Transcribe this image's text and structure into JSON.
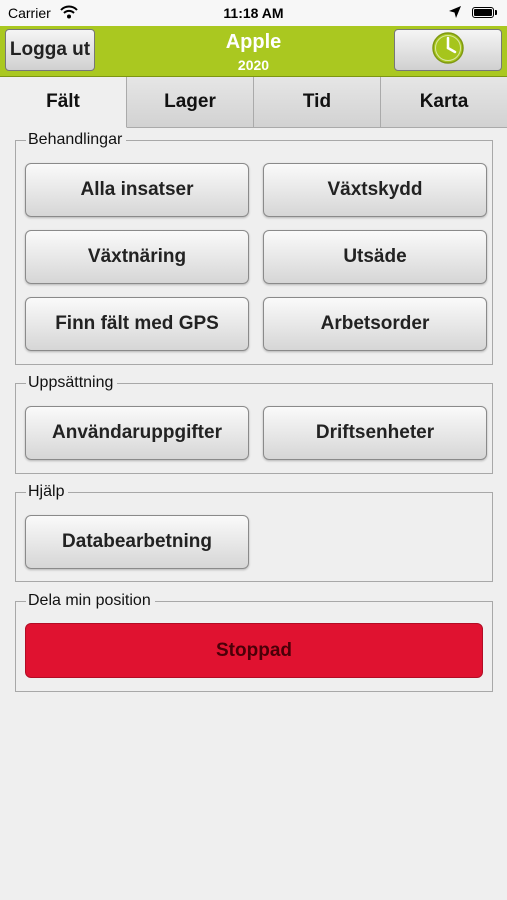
{
  "status_bar": {
    "carrier": "Carrier",
    "time": "11:18 AM"
  },
  "header": {
    "logout_label": "Logga ut",
    "title": "Apple",
    "subtitle": "2020"
  },
  "tabs": [
    {
      "label": "Fält",
      "active": true
    },
    {
      "label": "Lager",
      "active": false
    },
    {
      "label": "Tid",
      "active": false
    },
    {
      "label": "Karta",
      "active": false
    }
  ],
  "sections": {
    "behandlingar": {
      "label": "Behandlingar",
      "buttons": [
        "Alla insatser",
        "Växtskydd",
        "Växtnäring",
        "Utsäde",
        "Finn fält med GPS",
        "Arbetsorder"
      ]
    },
    "uppsattning": {
      "label": "Uppsättning",
      "buttons": [
        "Användaruppgifter",
        "Driftsenheter"
      ]
    },
    "hjalp": {
      "label": "Hjälp",
      "buttons": [
        "Databearbetning"
      ]
    },
    "dela": {
      "label": "Dela min position",
      "button": "Stoppad"
    }
  },
  "colors": {
    "header_bg": "#aac820",
    "stop_bg": "#e01230",
    "clock_icon": "#a6c51c"
  },
  "icons": {
    "wifi": "wifi-icon",
    "location": "location-arrow-icon",
    "battery": "battery-icon",
    "clock": "clock-icon"
  }
}
